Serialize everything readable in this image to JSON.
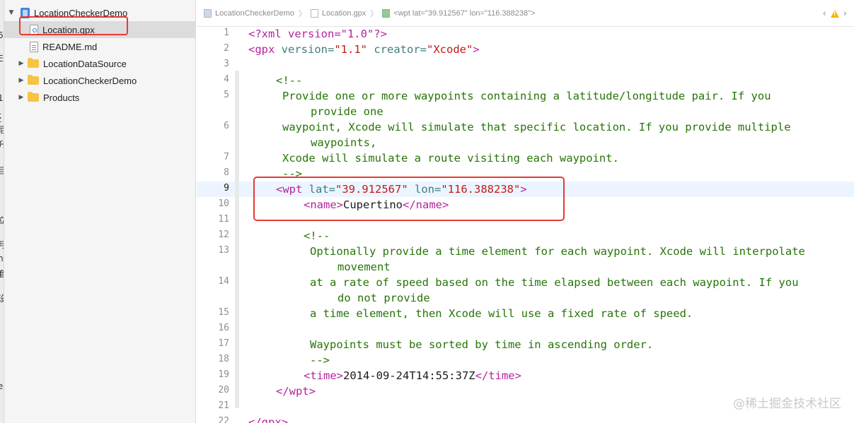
{
  "navigator": {
    "items": [
      {
        "label": "LocationCheckerDemo",
        "type": "project",
        "disclosure": "▼"
      },
      {
        "label": "Location.gpx",
        "type": "gpx-file",
        "selected": true
      },
      {
        "label": "README.md",
        "type": "md-file"
      },
      {
        "label": "LocationDataSource",
        "type": "folder",
        "disclosure": "▶"
      },
      {
        "label": "LocationCheckerDemo",
        "type": "folder",
        "disclosure": "▶"
      },
      {
        "label": "Products",
        "type": "folder",
        "disclosure": "▶"
      }
    ]
  },
  "jumpbar": {
    "crumbs": [
      "LocationCheckerDemo",
      "Location.gpx",
      "<wpt lat=\"39.912567\" lon=\"116.388238\">"
    ]
  },
  "left_strip": {
    "fragments": [
      "6",
      "E",
      "I",
      "1",
      "t",
      "t",
      "尼",
      "升",
      "目",
      "立",
      "月",
      "n",
      "套",
      "设",
      "e"
    ]
  },
  "editor": {
    "line_numbers": [
      "1",
      "2",
      "3",
      "4",
      "5",
      "",
      "6",
      "",
      "7",
      "8",
      "9",
      "10",
      "11",
      "12",
      "13",
      "",
      "14",
      "",
      "15",
      "16",
      "17",
      "18",
      "19",
      "20",
      "21",
      "22"
    ],
    "lines": {
      "l1": "<?xml version=\"1.0\"?>",
      "l2_open": "<gpx ",
      "l2_attr1": "version=",
      "l2_val1": "\"1.1\"",
      "l2_attr2": " creator=",
      "l2_val2": "\"Xcode\"",
      "l2_close": ">",
      "l4": "<!--",
      "l5a": "Provide one or more waypoints containing a latitude/longitude pair. If you",
      "l5b": "provide one",
      "l6a": "waypoint, Xcode will simulate that specific location. If you provide multiple",
      "l6b": "waypoints,",
      "l7": "Xcode will simulate a route visiting each waypoint.",
      "l8": "-->",
      "l9_open": "<wpt ",
      "l9_attr1": "lat=",
      "l9_val1": "\"39.912567\"",
      "l9_attr2": " lon=",
      "l9_val2": "\"116.388238\"",
      "l9_close": ">",
      "l10_open": "<name>",
      "l10_text": "Cupertino",
      "l10_close": "</name>",
      "l12": "<!--",
      "l13a": "Optionally provide a time element for each waypoint. Xcode will interpolate",
      "l13b": "movement",
      "l14a": "at a rate of speed based on the time elapsed between each waypoint. If you",
      "l14b": "do not provide",
      "l15": "a time element, then Xcode will use a fixed rate of speed.",
      "l17": "Waypoints must be sorted by time in ascending order.",
      "l18": "-->",
      "l19_open": "<time>",
      "l19_text": "2014-09-24T14:55:37Z",
      "l19_close": "</time>",
      "l20": "</wpt>",
      "l22": "</gpx>"
    }
  },
  "watermark": "@稀土掘金技术社区",
  "colors": {
    "tag": "#b5239d",
    "attribute": "#3f7d7d",
    "value": "#c41a16",
    "comment": "#267507",
    "highlight_box": "#e63a33"
  }
}
